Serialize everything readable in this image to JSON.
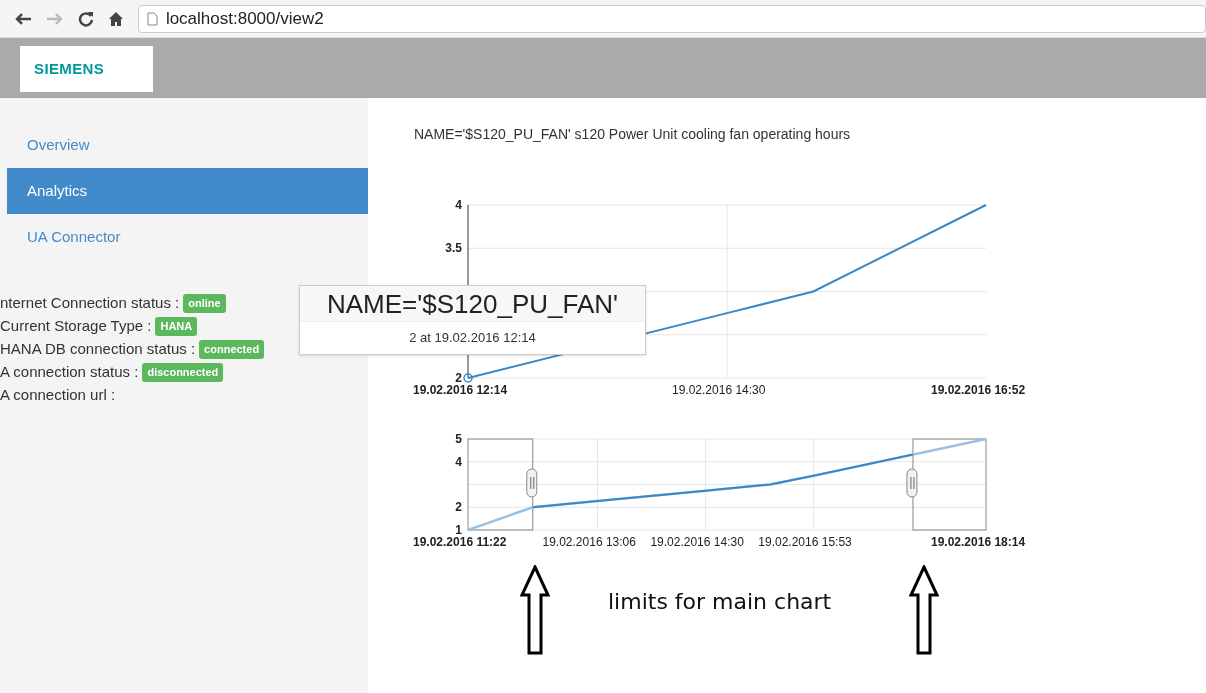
{
  "browser": {
    "url": "localhost:8000/view2"
  },
  "header": {
    "logo": "SIEMENS"
  },
  "sidebar": {
    "items": [
      {
        "label": "Overview",
        "selected": false
      },
      {
        "label": "Analytics",
        "selected": true
      },
      {
        "label": "UA Connector",
        "selected": false
      }
    ],
    "status": [
      {
        "label": "nternet Connection status :",
        "badge": "online"
      },
      {
        "label": "Current Storage Type :",
        "badge": "HANA"
      },
      {
        "label": "HANA DB connection status :",
        "badge": "connected"
      },
      {
        "label": "A connection status :",
        "badge": "disconnected"
      },
      {
        "label": "A connection url :"
      }
    ]
  },
  "main_chart": {
    "title": "NAME='$S120_PU_FAN' s120 Power Unit cooling fan operating hours",
    "chart_data": {
      "type": "line",
      "categories": [
        "19.02.2016 12:14",
        null,
        null,
        "19.02.2016 14:30",
        null,
        null,
        "19.02.2016 16:52"
      ],
      "ylim": [
        2,
        4
      ],
      "yticks": [
        2,
        3.5,
        4
      ],
      "grid": true,
      "series": [
        {
          "color": "#3a87c4",
          "values": [
            2,
            null,
            null,
            2.75,
            3,
            null,
            4
          ]
        }
      ]
    },
    "tooltip": {
      "title": "NAME='$S120_PU_FAN'",
      "text": "2 at 19.02.2016 12:14"
    }
  },
  "navigator_chart": {
    "chart_data": {
      "type": "line",
      "categories": [
        "19.02.2016 11:22",
        null,
        null,
        null,
        null,
        null,
        "19.02.2016 13:06",
        null,
        null,
        null,
        null,
        "19.02.2016 14:30",
        null,
        null,
        null,
        null,
        "19.02.2016 15:53",
        null,
        null,
        null,
        null,
        null,
        null,
        null,
        "19.02.2016 18:14"
      ],
      "ylim": [
        1,
        5
      ],
      "yticks": [
        1,
        2,
        4,
        5
      ],
      "grid": true,
      "series": [
        {
          "color": "#3a87c4",
          "values": [
            1,
            null,
            null,
            2,
            null,
            null,
            2.27,
            null,
            null,
            null,
            null,
            2.73,
            null,
            null,
            3,
            null,
            3.38,
            null,
            null,
            null,
            null,
            null,
            null,
            null,
            5
          ]
        }
      ]
    }
  },
  "annotation": "limits for main chart"
}
